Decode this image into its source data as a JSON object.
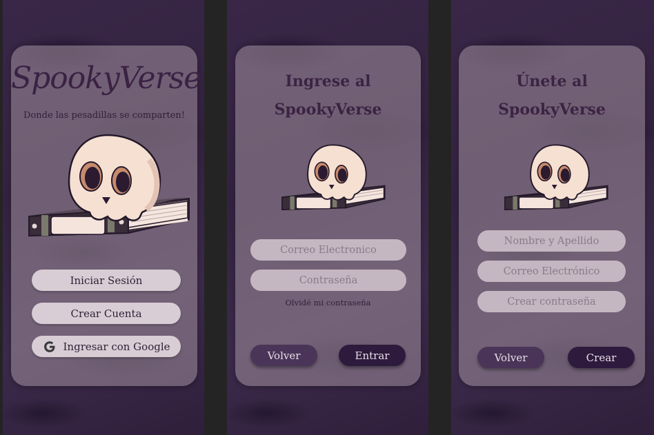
{
  "welcome": {
    "app_title": "SpookyVerse",
    "tagline": "Donde las pesadillas se comparten!",
    "login_label": "Iniciar Sesión",
    "create_account_label": "Crear Cuenta",
    "google_label": "Ingresar con Google",
    "icons": [
      "skull-book-icon",
      "google-icon"
    ]
  },
  "login": {
    "title_line1": "Ingrese al",
    "title_line2": "SpookyVerse",
    "email_placeholder": "Correo Electronico",
    "password_placeholder": "Contraseña",
    "forgot_label": "Olvidé mi contraseña",
    "back_label": "Volver",
    "submit_label": "Entrar"
  },
  "register": {
    "title_line1": "Únete al",
    "title_line2": "SpookyVerse",
    "name_placeholder": "Nombre y Apellido",
    "email_placeholder": "Correo Electrónico",
    "password_placeholder": "Crear contraseña",
    "back_label": "Volver",
    "submit_label": "Crear"
  },
  "colors": {
    "background": "#33223f",
    "card": "#968494",
    "dark_button": "#2e1a3d",
    "secondary_button": "#4a3559",
    "light_button": "#d8cdd4",
    "input": "#c4b7c1"
  }
}
